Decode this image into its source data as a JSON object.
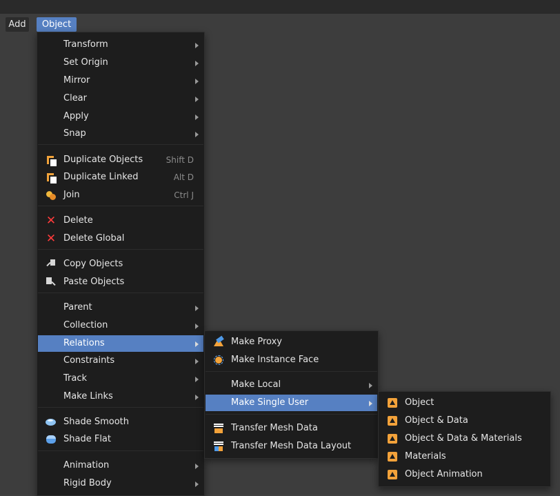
{
  "header": {
    "add_label": "Add",
    "object_label": "Object"
  },
  "menus": {
    "object": [
      {
        "label": "Transform",
        "submenu": true
      },
      {
        "label": "Set Origin",
        "submenu": true
      },
      {
        "label": "Mirror",
        "submenu": true
      },
      {
        "label": "Clear",
        "submenu": true
      },
      {
        "label": "Apply",
        "submenu": true
      },
      {
        "label": "Snap",
        "submenu": true
      },
      {
        "label": "Duplicate Objects",
        "shortcut": "Shift D",
        "icon": "duplicate-icon"
      },
      {
        "label": "Duplicate Linked",
        "shortcut": "Alt D",
        "icon": "duplicate-linked-icon"
      },
      {
        "label": "Join",
        "shortcut": "Ctrl J",
        "icon": "join-icon"
      },
      {
        "label": "Delete",
        "icon": "delete-icon"
      },
      {
        "label": "Delete Global",
        "icon": "delete-global-icon"
      },
      {
        "label": "Copy Objects",
        "icon": "copy-icon"
      },
      {
        "label": "Paste Objects",
        "icon": "paste-icon"
      },
      {
        "label": "Parent",
        "submenu": true
      },
      {
        "label": "Collection",
        "submenu": true
      },
      {
        "label": "Relations",
        "submenu": true,
        "highlighted": true
      },
      {
        "label": "Constraints",
        "submenu": true
      },
      {
        "label": "Track",
        "submenu": true
      },
      {
        "label": "Make Links",
        "submenu": true
      },
      {
        "label": "Shade Smooth",
        "icon": "shade-smooth-icon"
      },
      {
        "label": "Shade Flat",
        "icon": "shade-flat-icon"
      },
      {
        "label": "Animation",
        "submenu": true
      },
      {
        "label": "Rigid Body",
        "submenu": true
      }
    ],
    "relations": [
      {
        "label": "Make Proxy",
        "icon": "make-proxy-icon"
      },
      {
        "label": "Make Instance Face",
        "icon": "instance-face-icon"
      },
      {
        "label": "Make Local",
        "submenu": true
      },
      {
        "label": "Make Single User",
        "submenu": true,
        "highlighted": true
      },
      {
        "label": "Transfer Mesh Data",
        "icon": "transfer-mesh-data-icon"
      },
      {
        "label": "Transfer Mesh Data Layout",
        "icon": "transfer-mesh-layout-icon"
      }
    ],
    "single_user": [
      {
        "label": "Object",
        "icon": "object-data-icon"
      },
      {
        "label": "Object & Data",
        "icon": "object-data-icon"
      },
      {
        "label": "Object & Data & Materials",
        "icon": "object-data-icon"
      },
      {
        "label": "Materials",
        "icon": "object-data-icon"
      },
      {
        "label": "Object Animation",
        "icon": "object-data-icon"
      }
    ]
  },
  "colors": {
    "highlight": "#5680c2",
    "menu_bg": "#1d1d1d",
    "viewport_bg": "#3d3d3d",
    "delete_icon": "#ff3b3b",
    "object_icon": "#f3a23a"
  }
}
